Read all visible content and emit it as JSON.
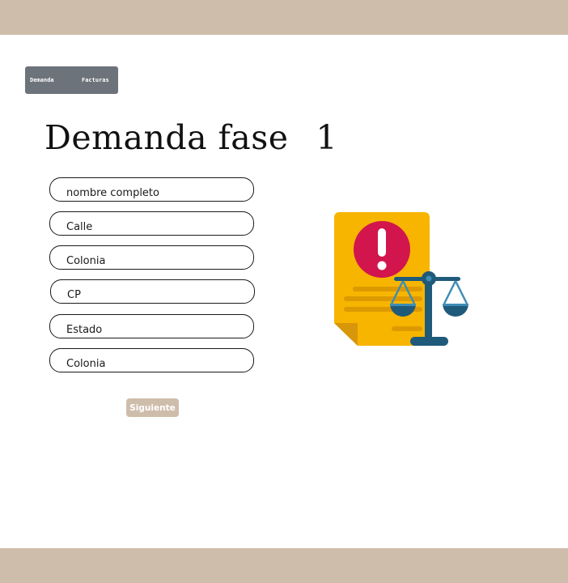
{
  "nav": {
    "items": [
      {
        "label": "Demanda"
      },
      {
        "label": "Facturas"
      }
    ]
  },
  "page": {
    "title": "Demanda fase",
    "phase": "1"
  },
  "form": {
    "fields": [
      {
        "placeholder": "nombre completo",
        "value": ""
      },
      {
        "placeholder": "Calle",
        "value": ""
      },
      {
        "placeholder": "Colonia",
        "value": ""
      },
      {
        "placeholder": "CP",
        "value": ""
      },
      {
        "placeholder": "Estado",
        "value": ""
      },
      {
        "placeholder": "Colonia",
        "value": ""
      }
    ],
    "next_label": "Siguiente"
  },
  "illustration": {
    "icon": "legal-document-scale-icon"
  },
  "colors": {
    "band": "#cfbdab",
    "nav_background": "#6c737b",
    "button_background": "#cfbdab",
    "document": "#f7b500",
    "alert": "#d2154d",
    "scale": "#1f5a7a"
  }
}
